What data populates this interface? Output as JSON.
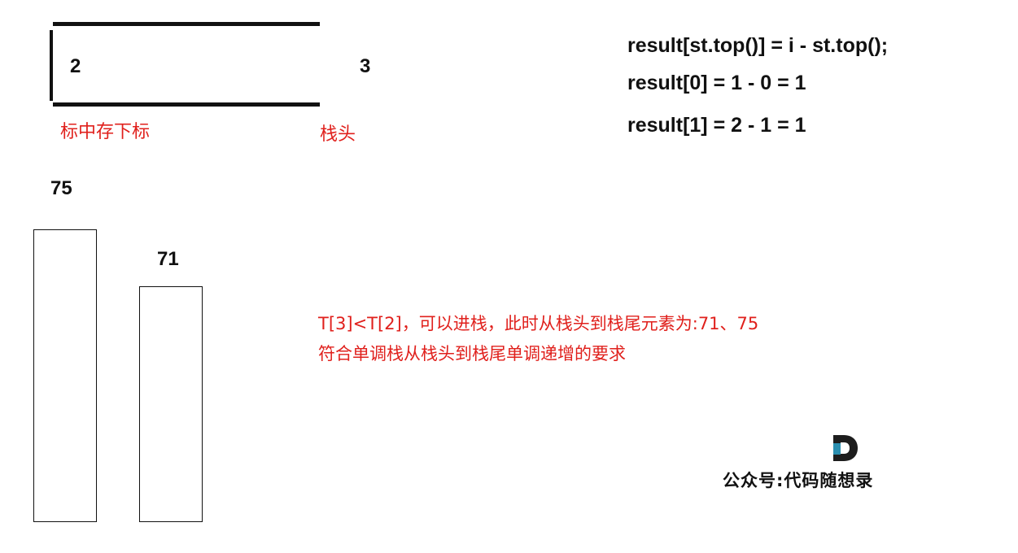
{
  "stack": {
    "values": [
      "2",
      "3"
    ],
    "label_index": "标中存下标",
    "label_head": "栈头"
  },
  "code": {
    "lines": [
      "result[st.top()] = i - st.top();",
      "result[0] = 1 - 0 = 1",
      "result[1] = 2 - 1 = 1"
    ]
  },
  "bars": {
    "items": [
      {
        "label": "75",
        "value": 75
      },
      {
        "label": "71",
        "value": 71
      }
    ]
  },
  "explanation": {
    "lines": [
      "T[3]<T[2]，可以进栈，此时从栈头到栈尾元素为:71、75",
      "符合单调栈从栈头到栈尾单调递增的要求"
    ]
  },
  "logo": {
    "text": "公众号:代码随想录",
    "icon": "d-logo-icon"
  },
  "colors": {
    "accent_red": "#e0201c",
    "ink": "#111111",
    "logo_blue": "#2b8fb0",
    "logo_dark": "#1d1d1d"
  }
}
